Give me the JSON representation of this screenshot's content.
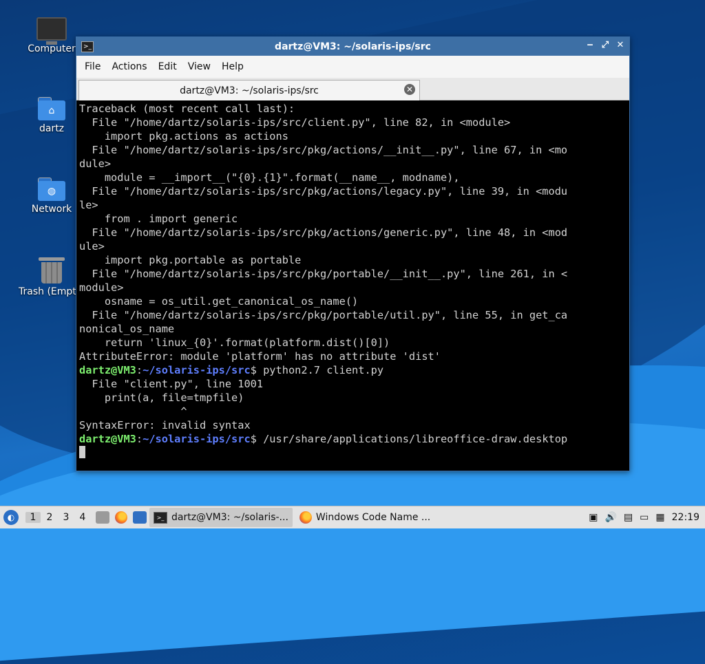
{
  "desktop": {
    "icons": [
      {
        "label": "Computer"
      },
      {
        "label": "dartz"
      },
      {
        "label": "Network"
      },
      {
        "label": "Trash (Empty)"
      }
    ]
  },
  "window": {
    "title": "dartz@VM3: ~/solaris-ips/src",
    "controls": {
      "minimize": "‒",
      "maximize": "⤢",
      "close": "✕"
    },
    "menu": [
      "File",
      "Actions",
      "Edit",
      "View",
      "Help"
    ],
    "tab": {
      "label": "dartz@VM3: ~/solaris-ips/src",
      "close": "✕"
    }
  },
  "terminal": {
    "prompt_user": "dartz@VM3",
    "prompt_sep": ":",
    "prompt_path": "~/solaris-ips/src",
    "prompt_end": "$",
    "lines": [
      "Traceback (most recent call last):",
      "  File \"/home/dartz/solaris-ips/src/client.py\", line 82, in <module>",
      "    import pkg.actions as actions",
      "  File \"/home/dartz/solaris-ips/src/pkg/actions/__init__.py\", line 67, in <mo",
      "dule>",
      "    module = __import__(\"{0}.{1}\".format(__name__, modname),",
      "  File \"/home/dartz/solaris-ips/src/pkg/actions/legacy.py\", line 39, in <modu",
      "le>",
      "    from . import generic",
      "  File \"/home/dartz/solaris-ips/src/pkg/actions/generic.py\", line 48, in <mod",
      "ule>",
      "    import pkg.portable as portable",
      "  File \"/home/dartz/solaris-ips/src/pkg/portable/__init__.py\", line 261, in <",
      "module>",
      "    osname = os_util.get_canonical_os_name()",
      "  File \"/home/dartz/solaris-ips/src/pkg/portable/util.py\", line 55, in get_ca",
      "nonical_os_name",
      "    return 'linux_{0}'.format(platform.dist()[0])",
      "AttributeError: module 'platform' has no attribute 'dist'"
    ],
    "cmd1": " python2.7 client.py",
    "lines2": [
      "  File \"client.py\", line 1001",
      "    print(a, file=tmpfile)",
      "                ^",
      "SyntaxError: invalid syntax"
    ],
    "cmd2": " /usr/share/applications/libreoffice-draw.desktop"
  },
  "taskbar": {
    "workspaces": [
      "1",
      "2",
      "3",
      "4"
    ],
    "tasks": [
      {
        "label": "dartz@VM3: ~/solaris-..."
      },
      {
        "label": "Windows Code Name ..."
      }
    ],
    "clock": "22:19"
  }
}
